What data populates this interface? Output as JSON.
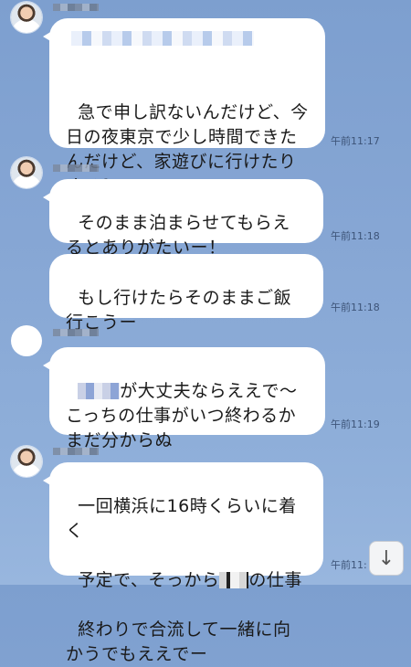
{
  "messages": [
    {
      "text_before": "",
      "text": "急で申し訳ないんだけど、今日の夜東京で少し時間できたんだけど、家遊びに行けたりする？",
      "time": "午前11:17"
    },
    {
      "text": "そのまま泊まらせてもらえるとありがたいー！",
      "time": "午前11:18"
    },
    {
      "text": "もし行けたらそのままご飯行こうー",
      "time": "午前11:18"
    },
    {
      "text_after_redact": "が大丈夫ならええで〜\nこっちの仕事がいつ終わるかまだ分からぬ",
      "time": "午前11:19"
    },
    {
      "text_line1": "一回横浜に16時くらいに着く",
      "text_line2_a": "予定で、そっから",
      "text_line2_b": "の仕事",
      "text_line3": "終わりで合流して一緒に向かうでもええでー",
      "time": "午前11:"
    }
  ],
  "icons": {
    "scroll_down": "arrow-down-icon"
  }
}
